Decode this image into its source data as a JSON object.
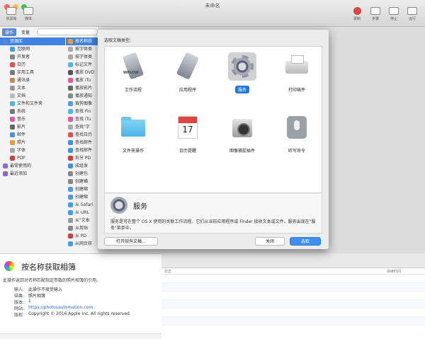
{
  "window": {
    "title": "未命名",
    "toolbar_left": [
      {
        "label": "资源库",
        "icon": "library-icon"
      },
      {
        "label": "媒体",
        "icon": "media-icon"
      }
    ],
    "toolbar_right": [
      {
        "label": "录制",
        "icon": "record-icon"
      },
      {
        "label": "步骤",
        "icon": "step-icon"
      },
      {
        "label": "停止",
        "icon": "stop-icon"
      },
      {
        "label": "运行",
        "icon": "run-icon"
      }
    ]
  },
  "library": {
    "tabs": [
      "操作",
      "变量"
    ],
    "categories": [
      {
        "label": "资源库",
        "color": "#5a88d6",
        "selected": true
      },
      {
        "label": "互联网",
        "color": "#4a9be8"
      },
      {
        "label": "开发者",
        "color": "#888888"
      },
      {
        "label": "日历",
        "color": "#e45050"
      },
      {
        "label": "实用工具",
        "color": "#777777"
      },
      {
        "label": "通讯录",
        "color": "#c08a50"
      },
      {
        "label": "文本",
        "color": "#999999"
      },
      {
        "label": "文档",
        "color": "#bbbbbb"
      },
      {
        "label": "文件和文件夹",
        "color": "#5ab4ec"
      },
      {
        "label": "系统",
        "color": "#777777"
      },
      {
        "label": "音乐",
        "color": "#e05aa0"
      },
      {
        "label": "影片",
        "color": "#666666"
      },
      {
        "label": "邮件",
        "color": "#4a90e0"
      },
      {
        "label": "照片",
        "color": "#e0a040"
      },
      {
        "label": "字体",
        "color": "#aaaaaa"
      },
      {
        "label": "PDF",
        "color": "#d04040"
      },
      {
        "label": "最常使用的",
        "color": "#8a6ad0"
      },
      {
        "label": "最近添加",
        "color": "#8a6ad0"
      }
    ],
    "actions": [
      {
        "label": "按名称获",
        "color": "#e0a040",
        "selected": true
      },
      {
        "label": "按字体类",
        "color": "#aaaaaa"
      },
      {
        "label": "按字体类",
        "color": "#aaaaaa"
      },
      {
        "label": "标记文件",
        "color": "#5ab4ec"
      },
      {
        "label": "播放 DVD",
        "color": "#555555"
      },
      {
        "label": "播放 iTu",
        "color": "#e05aa0"
      },
      {
        "label": "播放影片",
        "color": "#666666"
      },
      {
        "label": "播放通知",
        "color": "#888888"
      },
      {
        "label": "裁剪图像",
        "color": "#5a9be0"
      },
      {
        "label": "查找 Fin",
        "color": "#5ab4ec"
      },
      {
        "label": "查找 iTu",
        "color": "#e05aa0"
      },
      {
        "label": "查找\"字",
        "color": "#aaaaaa"
      },
      {
        "label": "查找日历",
        "color": "#e45050"
      },
      {
        "label": "查找邮件",
        "color": "#4a90e0"
      },
      {
        "label": "查找邮件",
        "color": "#4a90e0"
      },
      {
        "label": "拆分 PD",
        "color": "#d04040"
      },
      {
        "label": "成组发",
        "color": "#4a90e0"
      },
      {
        "label": "创建包",
        "color": "#888888"
      },
      {
        "label": "创建横",
        "color": "#888888"
      },
      {
        "label": "创建缩",
        "color": "#5a9be0"
      },
      {
        "label": "创建缩",
        "color": "#5a9be0"
      },
      {
        "label": "从 Safari",
        "color": "#4a9be8"
      },
      {
        "label": "从 URL",
        "color": "#4a9be8"
      },
      {
        "label": "从\"文本",
        "color": "#999999"
      },
      {
        "label": "从剪贴",
        "color": "#888888"
      },
      {
        "label": "从 PD",
        "color": "#d04040"
      },
      {
        "label": "从网页获",
        "color": "#4a9be8"
      }
    ],
    "last_action_full": "从网页获取链接 URL"
  },
  "description": {
    "title": "按名称获取相簿",
    "text": "此操作返回对名称匹配指定参数的照片相簿的引用。",
    "rows": [
      {
        "key": "输入:",
        "value": "此操作不接受输入"
      },
      {
        "key": "结果:",
        "value": "照片相簿"
      },
      {
        "key": "版本:",
        "value": "1"
      },
      {
        "key": "网站:",
        "value": "https://photosautomation.com",
        "link": true
      },
      {
        "key": "版权:",
        "value": "Copyright © 2016 Apple Inc. All rights reserved."
      }
    ]
  },
  "log": {
    "col_log": "日志",
    "col_duration": "持续时间"
  },
  "sheet": {
    "prompt": "选取文稿类型:",
    "types": [
      {
        "label": "工作流程",
        "art": "workflow",
        "selected": false,
        "art_text": "WFLOW"
      },
      {
        "label": "应用程序",
        "art": "application",
        "selected": false
      },
      {
        "label": "服务",
        "art": "service",
        "selected": true
      },
      {
        "label": "打印插件",
        "art": "printer",
        "selected": false
      },
      {
        "label": "文件夹操作",
        "art": "folder",
        "selected": false
      },
      {
        "label": "日历提醒",
        "art": "calendar",
        "selected": false,
        "art_text": "17"
      },
      {
        "label": "图像捕捉插件",
        "art": "camera",
        "selected": false
      },
      {
        "label": "听写命令",
        "art": "microphone",
        "selected": false
      }
    ],
    "info_title": "服务",
    "info_text": "服务是可在整个 OS X 使用的关联工作流程。它们从当前应用程序或 Finder 接收文本或文件。服务出现在\"服务\"菜单中。",
    "buttons": {
      "open_existing": "打开现有文稿...",
      "close": "关闭",
      "choose": "选取"
    }
  }
}
